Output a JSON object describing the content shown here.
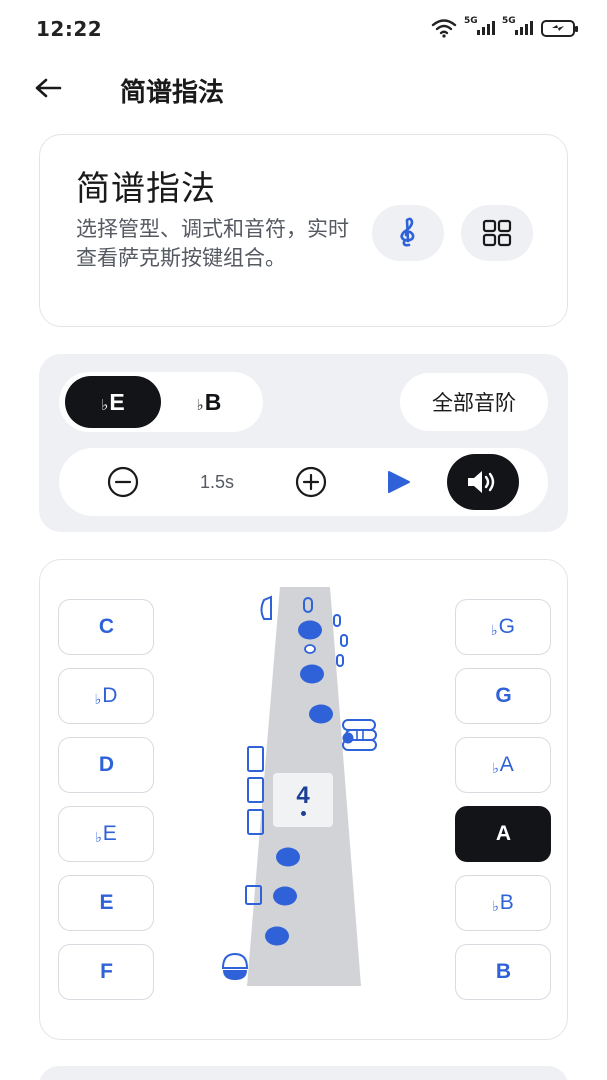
{
  "status_bar": {
    "time": "12:22",
    "network_labels": [
      "5G",
      "5G"
    ],
    "icons": [
      "wifi-icon",
      "signal-icon",
      "signal-icon",
      "battery-charging-icon"
    ]
  },
  "header": {
    "back_icon": "arrow-left-icon",
    "title": "简谱指法"
  },
  "intro": {
    "title": "简谱指法",
    "description": "选择管型、调式和音符，实时查看萨克斯按键组合。",
    "buttons": [
      {
        "icon": "treble-clef-icon"
      },
      {
        "icon": "grid-icon"
      }
    ]
  },
  "controls": {
    "keys": [
      {
        "flat": "♭",
        "letter": "E",
        "active": true
      },
      {
        "flat": "♭",
        "letter": "B",
        "active": false
      }
    ],
    "all_scales_label": "全部音阶",
    "speed": "1.5s",
    "icons": [
      "minus-circle-icon",
      "plus-circle-icon",
      "play-icon",
      "speaker-icon"
    ]
  },
  "fingering": {
    "left_notes": [
      {
        "flat": "",
        "letter": "C"
      },
      {
        "flat": "♭",
        "letter": "D"
      },
      {
        "flat": "",
        "letter": "D"
      },
      {
        "flat": "♭",
        "letter": "E"
      },
      {
        "flat": "",
        "letter": "E"
      },
      {
        "flat": "",
        "letter": "F"
      }
    ],
    "right_notes": [
      {
        "flat": "♭",
        "letter": "G"
      },
      {
        "flat": "",
        "letter": "G"
      },
      {
        "flat": "♭",
        "letter": "A"
      },
      {
        "flat": "",
        "letter": "A",
        "selected": true
      },
      {
        "flat": "♭",
        "letter": "B"
      },
      {
        "flat": "",
        "letter": "B"
      }
    ],
    "jianpu_number": "4",
    "colors": {
      "pressed_key": "#2f62d8",
      "sax_body": "#d2d3d6",
      "selected_note_bg": "#121417"
    }
  }
}
